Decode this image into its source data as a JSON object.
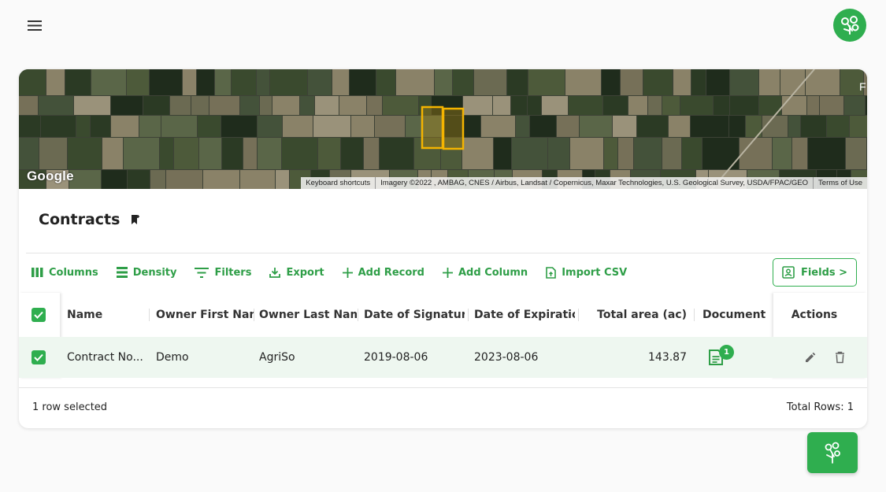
{
  "header": {
    "menu_icon": "hamburger-menu-icon",
    "logo_icon": "agriso-logo-icon"
  },
  "map": {
    "provider_logo": "Google",
    "attribution": {
      "shortcuts": "Keyboard shortcuts",
      "imagery": "Imagery ©2022 , AMBAG, CNES / Airbus, Landsat / Copernicus, Maxar Technologies, U.S. Geological Survey, USDA/FPAC/GEO",
      "terms": "Terms of Use"
    },
    "edge_letter": "F",
    "polygon_color": "#f4b400"
  },
  "contracts": {
    "title": "Contracts",
    "toolbar": {
      "columns": "Columns",
      "density": "Density",
      "filters": "Filters",
      "export": "Export",
      "add_record": "Add Record",
      "add_column": "Add Column",
      "import_csv": "Import CSV"
    },
    "fields_button": "Fields >",
    "columns": [
      "Name",
      "Owner First Name",
      "Owner Last Name",
      "Date of Signature",
      "Date of Expiration",
      "Total area (ac)",
      "Documents",
      "Actions"
    ],
    "rows": [
      {
        "name": "Contract No...",
        "owner_first": "Demo",
        "owner_last": "AgriSo",
        "signature": "2019-08-06",
        "expiration": "2023-08-06",
        "area": "143.87",
        "documents_count": "1"
      }
    ],
    "footer": {
      "selected": "1 row selected",
      "total": "Total Rows: 1"
    }
  },
  "colors": {
    "accent": "#2fae4f",
    "accent_text": "#2e9e47",
    "selected_row": "#eef7f0"
  }
}
